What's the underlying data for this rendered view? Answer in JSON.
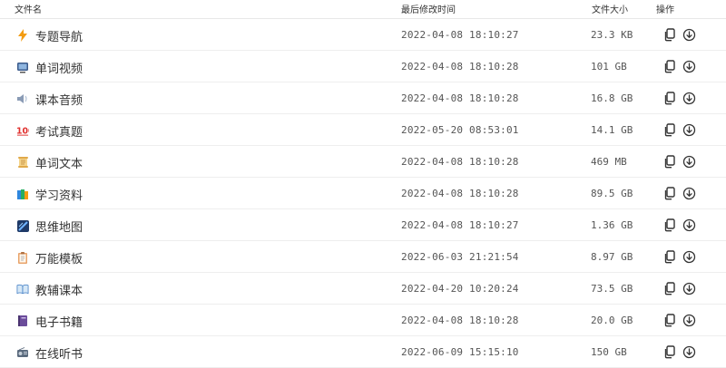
{
  "columns": {
    "name": "文件名",
    "modified": "最后修改时间",
    "size": "文件大小",
    "actions": "操作"
  },
  "files": [
    {
      "icon": "lightning-icon",
      "name": "专题导航",
      "modified": "2022-04-08 18:10:27",
      "size": "23.3 KB"
    },
    {
      "icon": "tv-icon",
      "name": "单词视频",
      "modified": "2022-04-08 18:10:28",
      "size": "101 GB"
    },
    {
      "icon": "speaker-icon",
      "name": "课本音频",
      "modified": "2022-04-08 18:10:28",
      "size": "16.8 GB"
    },
    {
      "icon": "hundred-points-icon",
      "name": "考试真题",
      "modified": "2022-05-20 08:53:01",
      "size": "14.1 GB"
    },
    {
      "icon": "scroll-icon",
      "name": "单词文本",
      "modified": "2022-04-08 18:10:28",
      "size": "469 MB"
    },
    {
      "icon": "books-icon",
      "name": "学习资料",
      "modified": "2022-04-08 18:10:28",
      "size": "89.5 GB"
    },
    {
      "icon": "mindmap-icon",
      "name": "思维地图",
      "modified": "2022-04-08 18:10:27",
      "size": "1.36 GB"
    },
    {
      "icon": "clipboard-icon",
      "name": "万能模板",
      "modified": "2022-06-03 21:21:54",
      "size": "8.97 GB"
    },
    {
      "icon": "open-book-icon",
      "name": "教辅课本",
      "modified": "2022-04-20 10:20:24",
      "size": "73.5 GB"
    },
    {
      "icon": "notebook-icon",
      "name": "电子书籍",
      "modified": "2022-04-08 18:10:28",
      "size": "20.0 GB"
    },
    {
      "icon": "radio-icon",
      "name": "在线听书",
      "modified": "2022-06-09 15:15:10",
      "size": "150 GB"
    }
  ],
  "action_icons": {
    "copy": "copy-icon",
    "download": "download-icon"
  }
}
